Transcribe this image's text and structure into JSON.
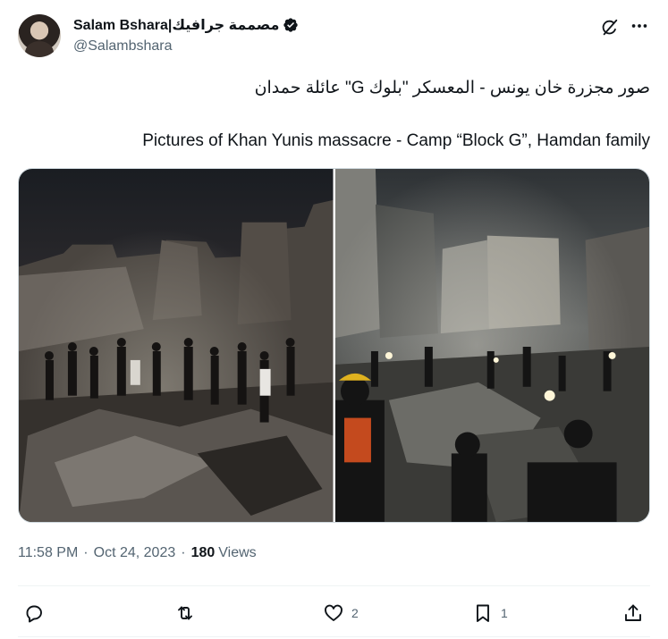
{
  "author": {
    "display_name": "Salam Bshara|مصممة جرافيك",
    "handle": "@Salambshara",
    "verified": true
  },
  "tweet": {
    "text_arabic": "صور مجزرة خان يونس - المعسكر \"بلوك G\" عائلة حمدان",
    "text_english": "Pictures of Khan Yunis massacre -  Camp “Block G”, Hamdan family"
  },
  "media": {
    "count": 2
  },
  "meta": {
    "time": "11:58 PM",
    "separator": "·",
    "date": "Oct 24, 2023",
    "views_count": "180",
    "views_label": "Views"
  },
  "actions": {
    "reply_count": "",
    "retweet_count": "",
    "like_count": "2",
    "bookmark_count": "1"
  },
  "colors": {
    "text_primary": "#0f1419",
    "text_secondary": "#536471",
    "border": "#cfd9de",
    "divider": "#eff3f4"
  },
  "icons": [
    "verified-badge-icon",
    "grok-icon",
    "more-icon",
    "reply-icon",
    "retweet-icon",
    "like-icon",
    "bookmark-icon",
    "share-icon"
  ]
}
